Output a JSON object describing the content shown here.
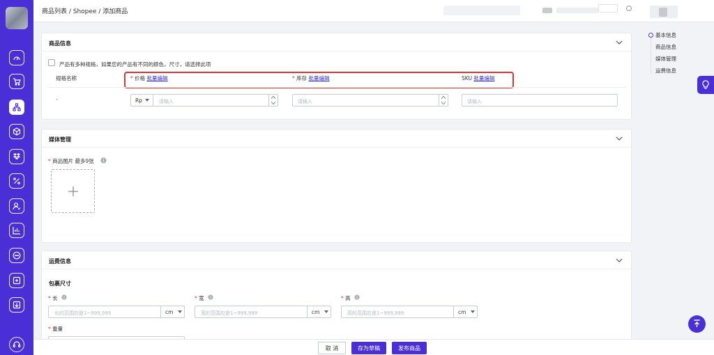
{
  "breadcrumb": "商品列表 / Shopee / 添加商品",
  "sidebar": {
    "icons": [
      "dashboard-icon",
      "cart-icon",
      "product-tree-icon",
      "package-icon",
      "dropbox-icon",
      "percent-icon",
      "customer-icon",
      "analytics-icon",
      "chat-icon",
      "store-icon",
      "import-icon",
      "support-icon"
    ]
  },
  "product_info": {
    "title": "商品信息",
    "variation_checkbox": "产品有多种规格，如果您的产品有不同的颜色，尺寸，请选择此项",
    "col_spec": "规格名称",
    "col_price": "价格",
    "col_stock": "库存",
    "col_sku": "SKU",
    "bulk_edit": "批量编辑",
    "spec_value": "-",
    "currency": "Rp",
    "price_placeholder": "请输入",
    "stock_placeholder": "请输入",
    "sku_placeholder": "请输入"
  },
  "media": {
    "title": "媒体管理",
    "images_label": "商品图片 最多9张"
  },
  "shipping": {
    "title": "运费信息",
    "package_size": "包裹尺寸",
    "length_label": "长",
    "length_placeholder": "长的范围应是1~999,999",
    "width_label": "宽",
    "width_placeholder": "宽的范围应是1~999,999",
    "height_label": "高",
    "height_placeholder": "高的范围应是1~999,999",
    "unit": "cm",
    "weight_label": "重量"
  },
  "anchors": {
    "items": [
      "基本信息",
      "商品信息",
      "媒体管理",
      "运费信息"
    ]
  },
  "footer": {
    "cancel": "取 消",
    "save_draft": "存为草稿",
    "publish": "发布商品"
  },
  "colors": {
    "primary": "#4a2fd6",
    "required": "#e03131",
    "highlight": "#e0342c",
    "link": "#2f2bd9"
  }
}
